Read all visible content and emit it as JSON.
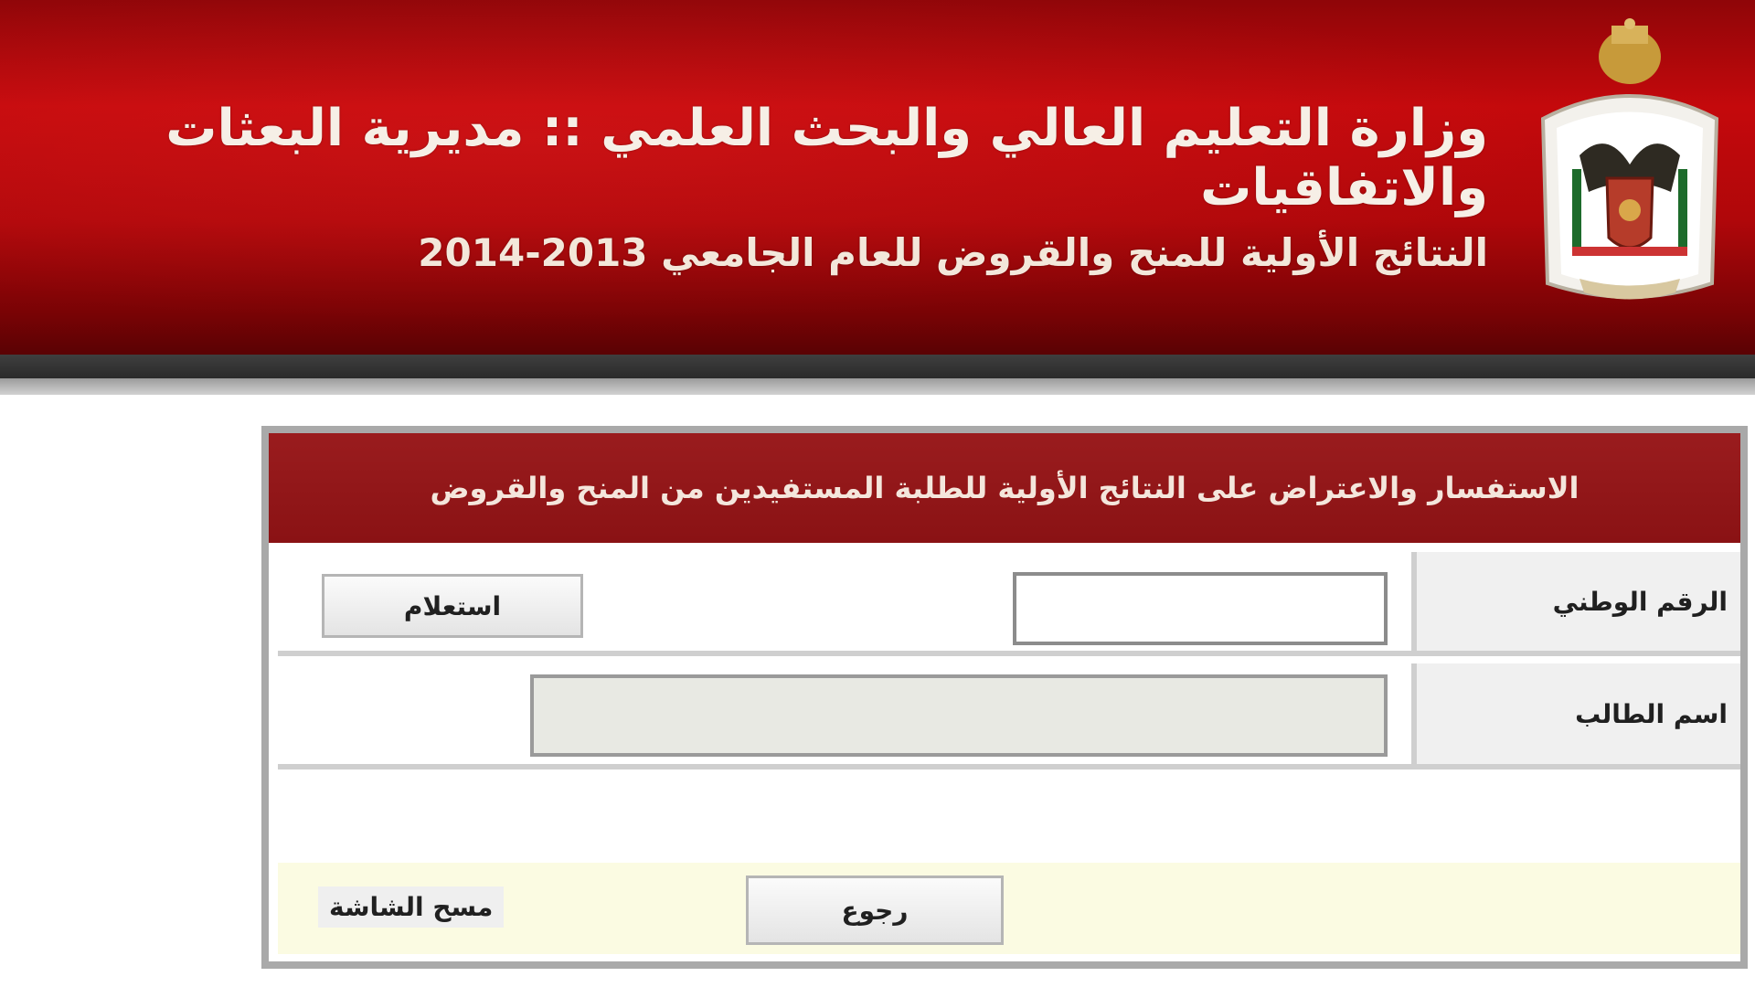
{
  "header": {
    "title": "وزارة التعليم العالي والبحث العلمي :: مديرية البعثات والاتفاقيات",
    "subtitle": "النتائج الأولية للمنح والقروض للعام الجامعي 2013-2014",
    "emblem": "jordan-coat-of-arms"
  },
  "form": {
    "panel_title": "الاستفسار والاعتراض على النتائج الأولية للطلبة المستفيدين من المنح والقروض",
    "national_id": {
      "label": "الرقم الوطني",
      "value": "",
      "placeholder": ""
    },
    "search_button_label": "استعلام",
    "student_name": {
      "label": "اسم الطالب",
      "value": ""
    },
    "clear_label": "مسح الشاشة",
    "confirm_button_label": "رجوع"
  },
  "colors": {
    "header_red": "#b0070a",
    "panel_header_red": "#8a1214",
    "footer_background": "#fbfbe2",
    "disabled_input": "#e8e9e3"
  }
}
